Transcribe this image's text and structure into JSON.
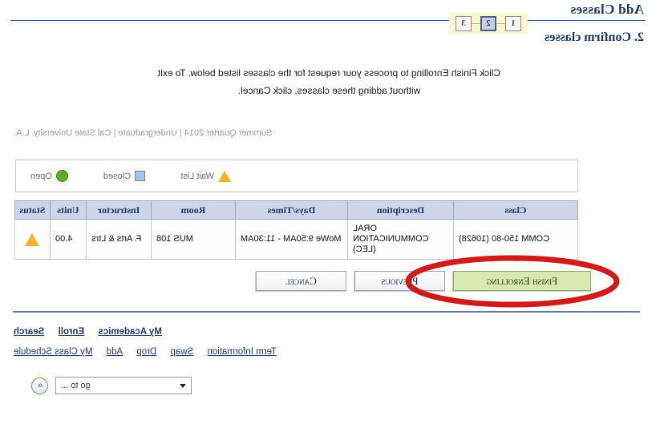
{
  "header": {
    "page_title": "Add Classes",
    "section_title": "2. Confirm classes",
    "steps": [
      "1",
      "2",
      "3"
    ],
    "active_step": "2"
  },
  "instructions": {
    "text": "Click Finish Enrolling to process your request for the classes listed below. To exit without adding these classes, click Cancel."
  },
  "term": {
    "line": "Summer Quarter 2014 | Undergraduate | Cal State University, L.A."
  },
  "legend": {
    "open_label": "Open",
    "closed_label": "Closed",
    "waitlist_label": "Wait List",
    "open_color": "#5db024",
    "closed_color": "#a8c6ea",
    "waitlist_color": "#f5b423"
  },
  "table": {
    "headers": [
      "Class",
      "Description",
      "Days/Times",
      "Room",
      "Instructor",
      "Units",
      "Status"
    ],
    "rows": [
      {
        "class": "COMM 150-80 (10628)",
        "description": "ORAL COMMUNICATION (LEC)",
        "days_times": "MoWe 9:50AM - 11:30AM",
        "room": "MUS 108",
        "instructor": "F. Arts & Ltrs",
        "units": "4.00",
        "status_icon": "wait-list-triangle-icon"
      }
    ]
  },
  "buttons": {
    "cancel": "Cancel",
    "previous": "Previous",
    "finish_enrolling": "Finish Enrolling",
    "primary_color": "#d8e8b0"
  },
  "footer": {
    "primary_links": [
      "Search",
      "Enroll",
      "My Academics"
    ],
    "secondary_links": [
      "My Class Schedule",
      "Add",
      "Drop",
      "Swap",
      "Term Information"
    ]
  },
  "goto": {
    "placeholder": "go to ...",
    "button_icon": "double-chevron-left-icon",
    "caret_icon": "chevron-down-icon"
  },
  "annotation": {
    "shape": "red-ellipse-highlight",
    "color": "#d01b1b",
    "target": "finish-enrolling-button"
  }
}
